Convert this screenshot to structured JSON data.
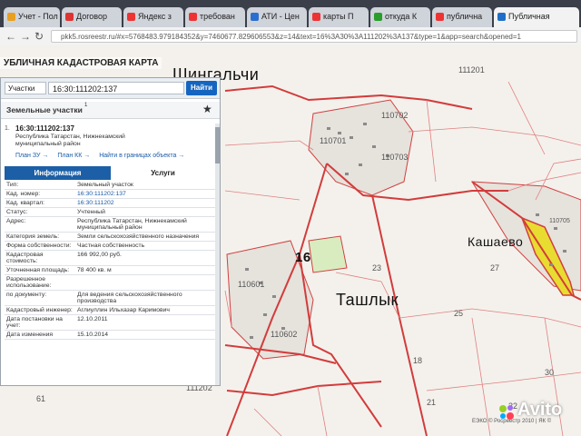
{
  "browser": {
    "tabs": [
      {
        "label": "Учет - Пол",
        "color": "#e8a020"
      },
      {
        "label": "Договор",
        "color": "#d33"
      },
      {
        "label": "Яндекс з",
        "color": "#e33"
      },
      {
        "label": "требован",
        "color": "#e33"
      },
      {
        "label": "АТИ - Цен",
        "color": "#2a6fd0"
      },
      {
        "label": "карты П",
        "color": "#e33"
      },
      {
        "label": "откуда К",
        "color": "#2a9d2a"
      },
      {
        "label": "публична",
        "color": "#e33"
      },
      {
        "label": "Публичная",
        "color": "#1f6fc9"
      }
    ],
    "url": "pkk5.rosreestr.ru/#x=5768483.979184352&y=7460677.829606553&z=14&text=16%3A30%3A111202%3A137&type=1&app=search&opened=1"
  },
  "page_title": "УБЛИЧНАЯ КАДАСТРОВАЯ КАРТА",
  "search": {
    "category": "Участки",
    "query": "16:30:111202:137",
    "button": "Найти"
  },
  "section": {
    "title": "Земельные участки",
    "count": "1"
  },
  "result": {
    "number": "1.",
    "id": "16:30:111202:137",
    "address": "Республика Татарстан, Нижнекамский муниципальный район",
    "links": [
      "План ЗУ →",
      "План КК →",
      "Найти в границах объекта →"
    ]
  },
  "tabs": [
    "Информация",
    "Услуги"
  ],
  "properties": [
    {
      "k": "Тип:",
      "v": "Земельный участок",
      "link": false
    },
    {
      "k": "Кад. номер:",
      "v": "16:30:111202:137",
      "link": true
    },
    {
      "k": "Кад. квартал:",
      "v": "16:30:111202",
      "link": true
    },
    {
      "k": "Статус:",
      "v": "Учтенный",
      "link": false
    },
    {
      "k": "Адрес:",
      "v": "Республика Татарстан, Нижнекамский муниципальный район",
      "link": false
    },
    {
      "k": "Категория земель:",
      "v": "Земли сельскохозяйственного назначения",
      "link": false
    },
    {
      "k": "Форма собственности:",
      "v": "Частная собственность",
      "link": false
    },
    {
      "k": "Кадастровая стоимость:",
      "v": "166 992,00 руб.",
      "link": false
    },
    {
      "k": "Уточненная площадь:",
      "v": "78 400 кв. м",
      "link": false
    },
    {
      "k": "Разрешенное использование:",
      "v": "",
      "link": false
    },
    {
      "k": "по документу:",
      "v": "Для ведения сельскохозяйственного производства",
      "link": false
    },
    {
      "k": "Кадастровый инженер:",
      "v": "Аглиуллин Ильхазар Каримович",
      "link": false
    },
    {
      "k": "Дата постановки на учет:",
      "v": "12.10.2011",
      "link": false
    },
    {
      "k": "Дата изменения",
      "v": "15.10.2014",
      "link": false
    }
  ],
  "map": {
    "town1": "Шингальчи",
    "town2": "Ташлык",
    "town3": "Кашаево",
    "district": "16",
    "labels": [
      "111201",
      "110702",
      "110701",
      "110703",
      "110601",
      "110602",
      "111202",
      "23",
      "27",
      "25",
      "30",
      "18",
      "61",
      "21",
      "22",
      "110705"
    ],
    "copyright": "ЕЭКО © Росреестр 2010 | ЯК ©"
  },
  "watermark": "Avito"
}
